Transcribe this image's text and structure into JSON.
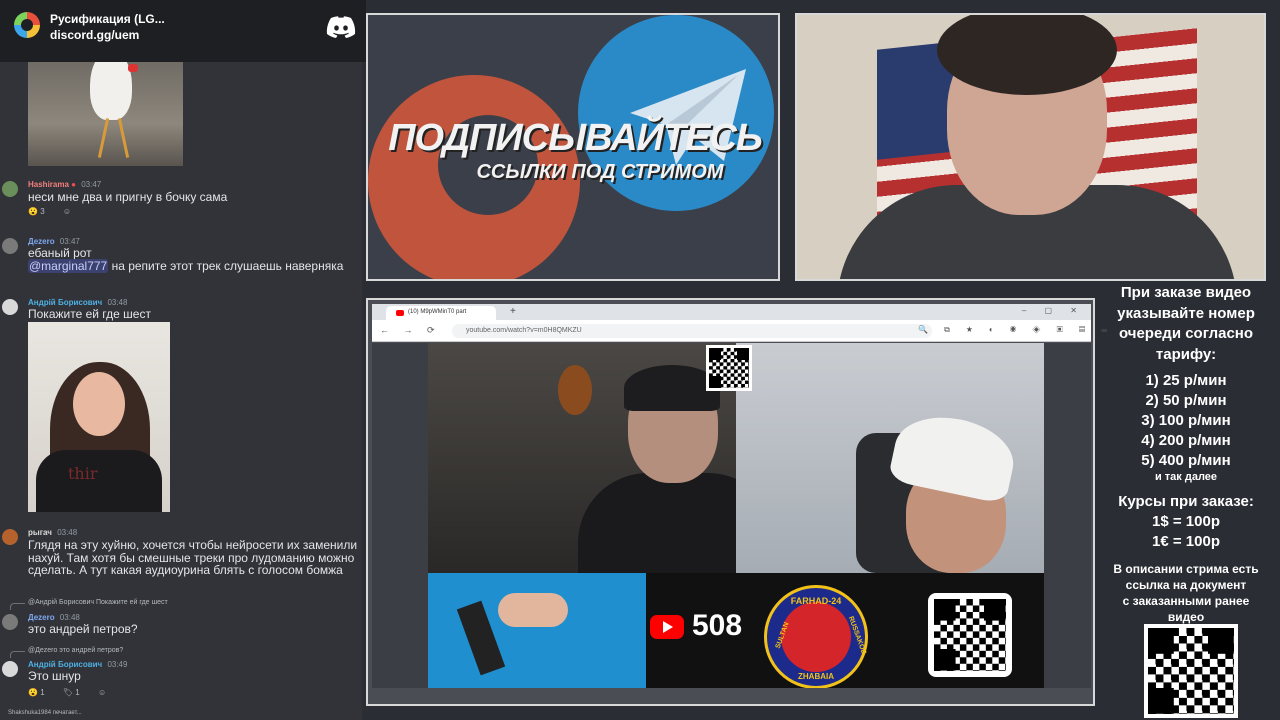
{
  "server": {
    "name": "Русификация (LG...",
    "invite": "discord.gg/uem",
    "icon": "discord-icon"
  },
  "chat": {
    "messages": [
      {
        "user": "Hashirama",
        "user_color": "#f27e7e",
        "time": "03:47",
        "text": "неси мне два и пригну в бочку сама",
        "reactions": [
          "3"
        ]
      },
      {
        "user": "Дezero",
        "user_color": "#7ea8f2",
        "time": "03:47",
        "text_line1": "ебаный рот",
        "mention": "@marginal777",
        "text_line2": " на репите этот трек слушаешь наверняка"
      },
      {
        "user": "Андрій Борисович",
        "user_color": "#4fb0e3",
        "time": "03:48",
        "text": "Покажите ей где шест"
      },
      {
        "user": "рыгач",
        "user_color": "#dcdcdc",
        "time": "03:48",
        "text": "Глядя на эту хуйню, хочется чтобы нейросети их заменили нахуй. Там хотя бы смешные треки про лудоманию можно сделать. А тут какая аудиоурина блять с голосом бомжа"
      },
      {
        "reply": "@Андрій Борисович Покажите ей где шест",
        "user": "Дezero",
        "user_color": "#7ea8f2",
        "time": "03:48",
        "text": "это андрей петров?"
      },
      {
        "reply": "@Дezero это андрей петров?",
        "user": "Андрій Борисович",
        "user_color": "#4fb0e3",
        "time": "03:49",
        "text": "Это шнур",
        "reactions": [
          "1",
          "1"
        ]
      }
    ],
    "typing": "Shakshuka1984 печатает..."
  },
  "promo": {
    "title": "ПОДПИСЫВАЙТЕСЬ",
    "subtitle": "ССЫЛКИ ПОД СТРИМОМ"
  },
  "browser": {
    "tab_title": "(10) M9pWMinT0 part",
    "new_tab": "+",
    "window_controls": "– ▢ ✕",
    "nav": "← → ⟳",
    "url": "youtube.com/watch?v=m0H8QMKZU",
    "extensions": "🔍 ⧉ ★ ◐ ◉ ◈ ▣ ▤ ☰ ⋮"
  },
  "video": {
    "subscriber_count": "508",
    "emblem_top": "FARHAD-24",
    "emblem_left": "SULTAN",
    "emblem_right": "RUSSAKOB",
    "emblem_bottom": "ZHABAIA"
  },
  "pricing": {
    "heading_lines": [
      "При заказе видео",
      "указывайте номер",
      "очереди согласно",
      "тарифу:"
    ],
    "tiers": [
      "1) 25 р/мин",
      "2) 50 р/мин",
      "3) 100 р/мин",
      "4) 200 р/мин",
      "5) 400 р/мин"
    ],
    "and_so_on": "и так далее",
    "rates_heading": "Курсы при заказе:",
    "rates": [
      "1$ = 100р",
      "1€ = 100р"
    ],
    "description_lines": [
      "В описании стрима есть",
      "ссылка на документ",
      "с заказанными ранее",
      "видео"
    ]
  }
}
